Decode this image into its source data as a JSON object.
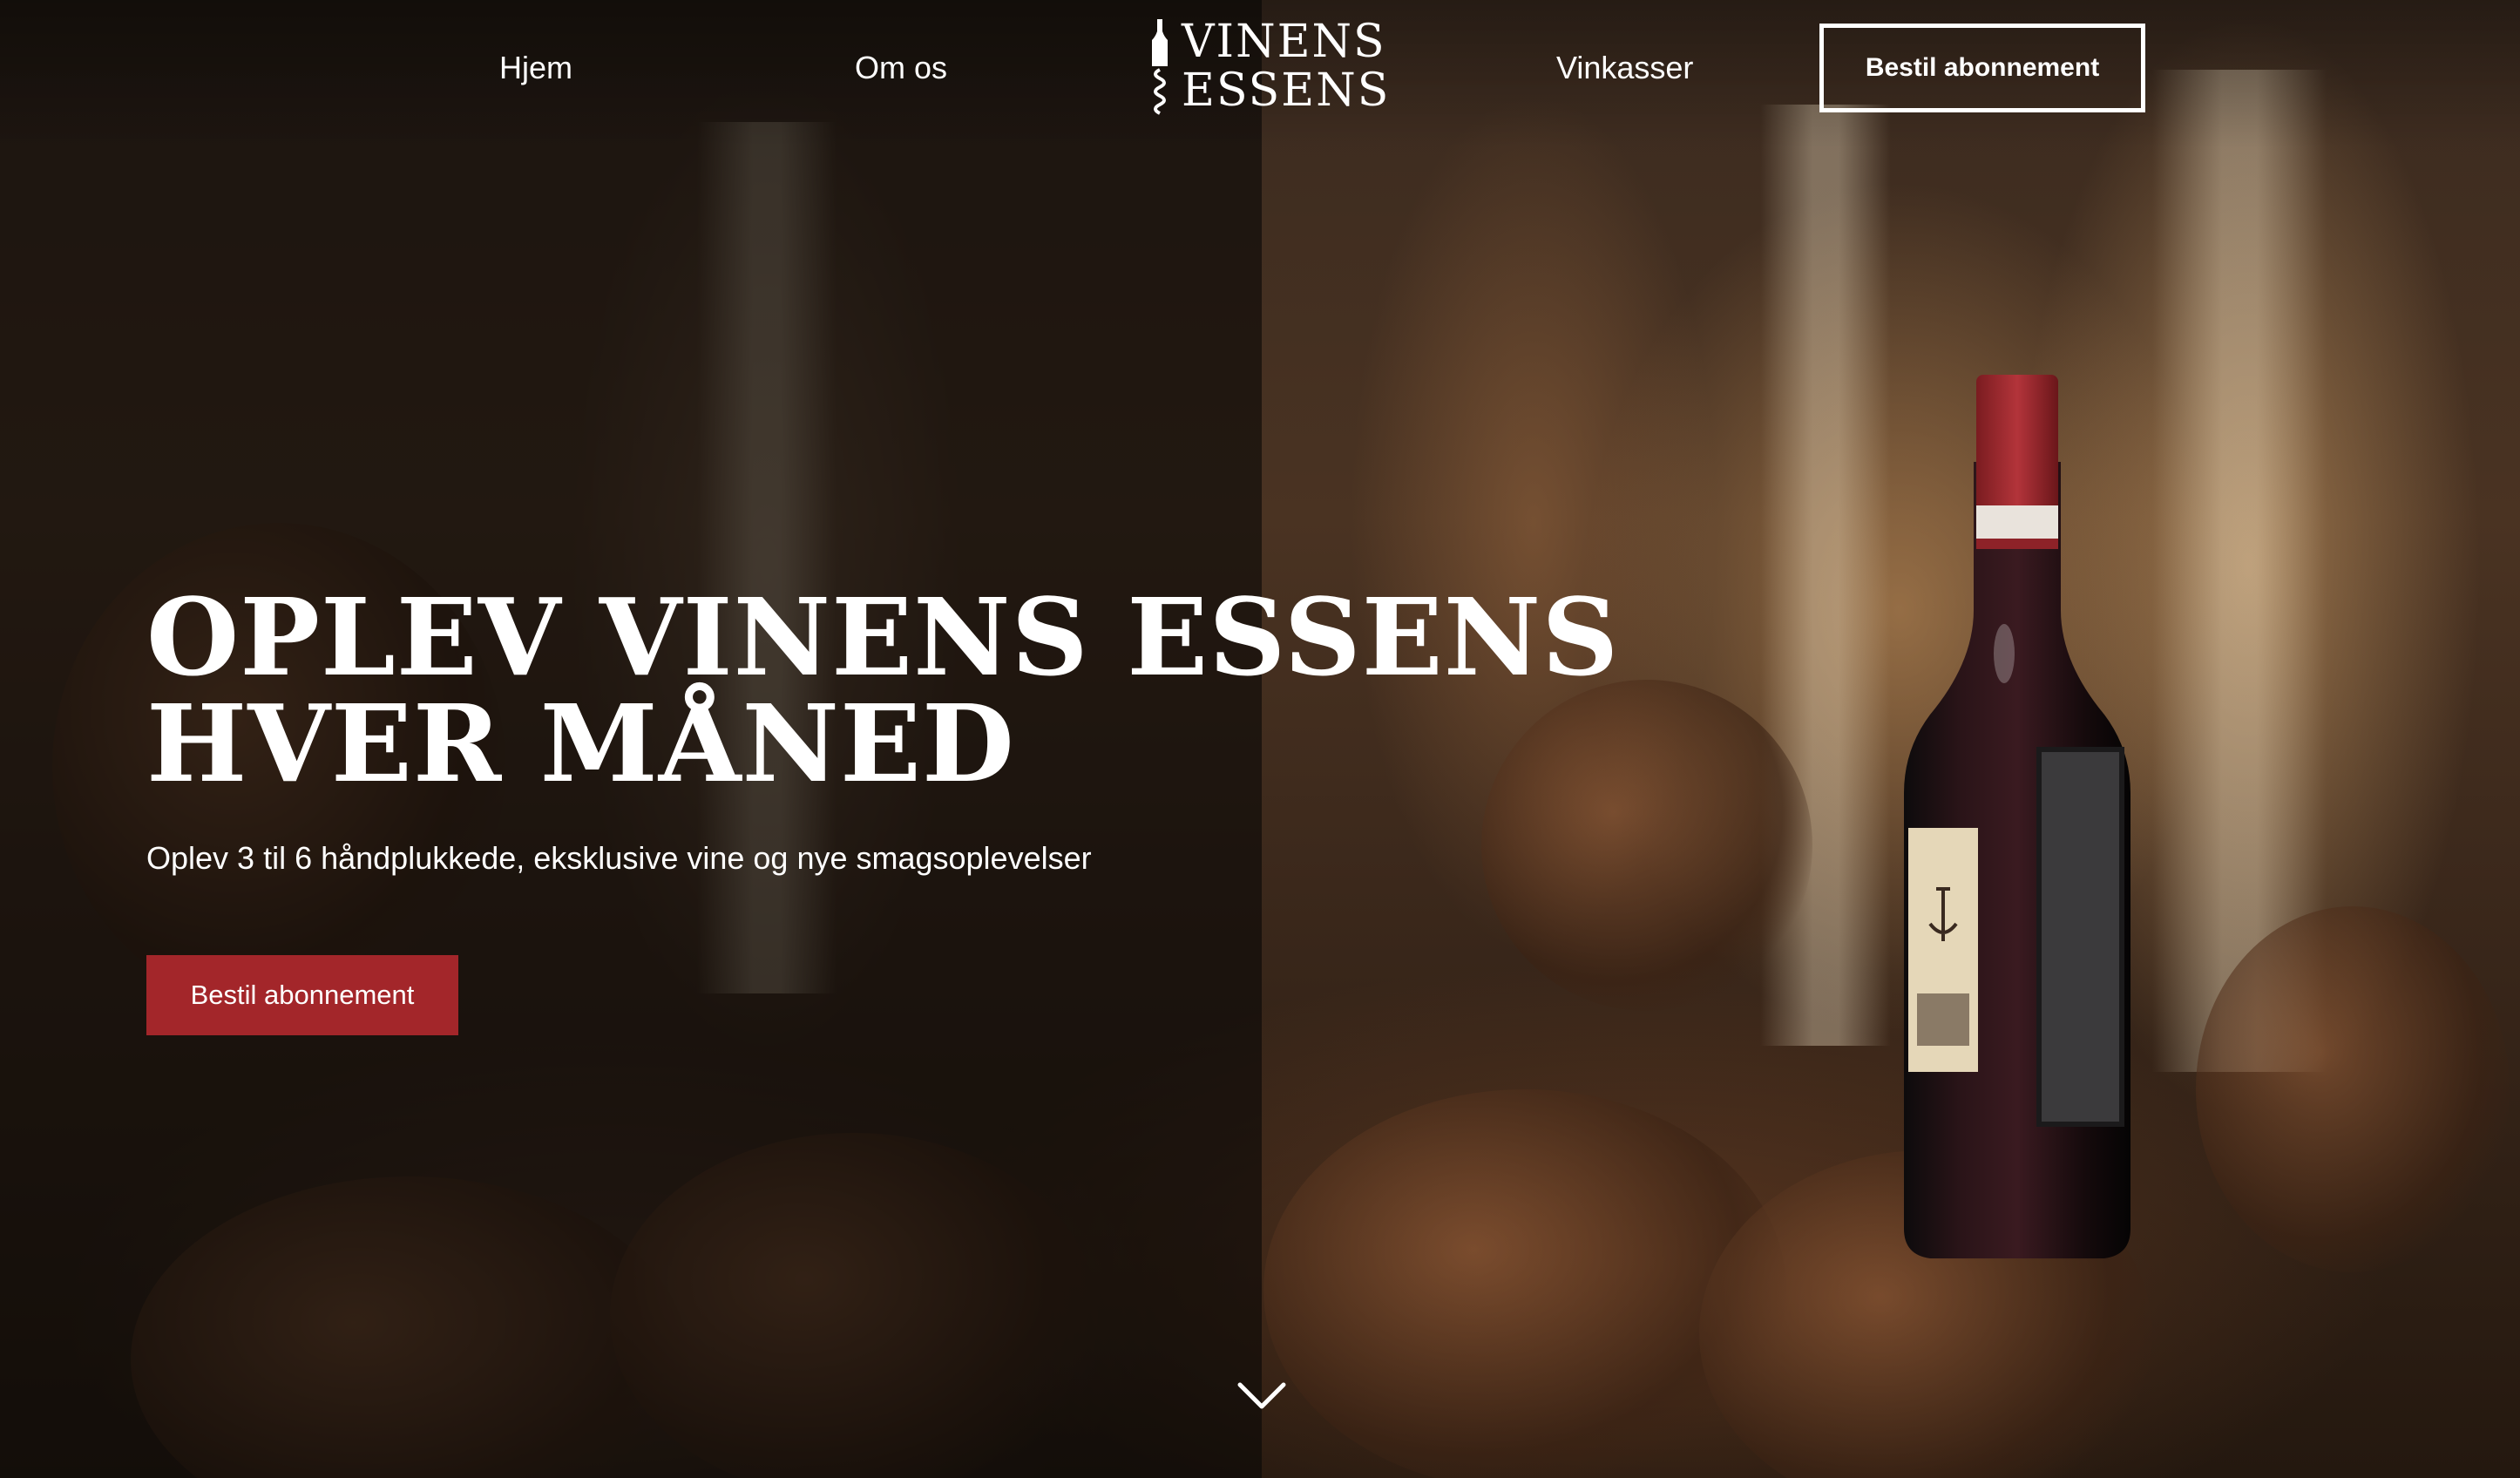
{
  "nav": {
    "items": [
      {
        "label": "Hjem"
      },
      {
        "label": "Om os"
      },
      {
        "label": "Vinkasser"
      }
    ],
    "cta_label": "Bestil abonnement"
  },
  "logo": {
    "line1": "VINENS",
    "line2": "ESSENS",
    "icon": "corkscrew-bottle-icon"
  },
  "hero": {
    "title_line1": "OPLEV VINENS ESSENS",
    "title_line2": "HVER MÅNED",
    "subtitle": "Oplev 3 til 6 håndplukkede, eksklusive vine og nye smagsoplevelser",
    "cta_label": "Bestil abonnement",
    "product_image": "red-wine-bottle",
    "scroll_icon": "chevron-down-icon"
  },
  "colors": {
    "accent": "#a3262a",
    "text": "#ffffff"
  }
}
